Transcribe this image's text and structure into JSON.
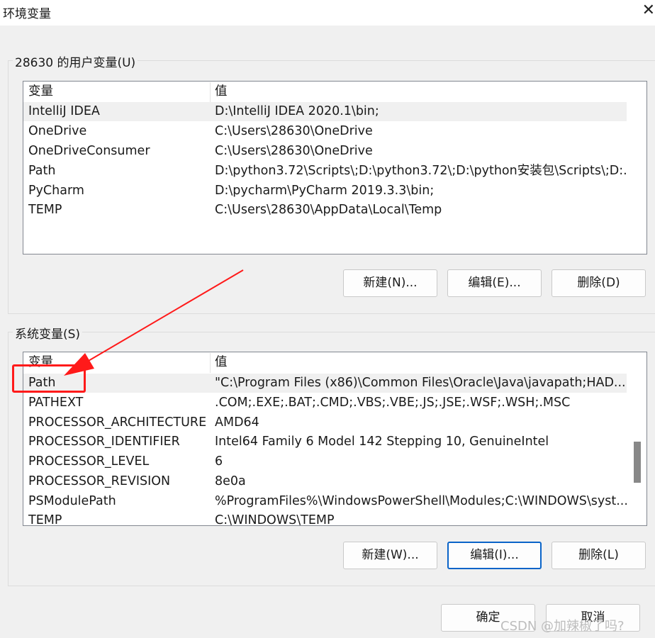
{
  "window": {
    "title": "环境变量",
    "close_glyph": "✕"
  },
  "user_vars": {
    "label": "28630 的用户变量(U)",
    "headers": {
      "var": "变量",
      "val": "值"
    },
    "rows": [
      {
        "var": "IntelliJ IDEA",
        "val": "D:\\IntelliJ IDEA 2020.1\\bin;"
      },
      {
        "var": "OneDrive",
        "val": "C:\\Users\\28630\\OneDrive"
      },
      {
        "var": "OneDriveConsumer",
        "val": "C:\\Users\\28630\\OneDrive"
      },
      {
        "var": "Path",
        "val": "D:\\python3.72\\Scripts\\;D:\\python3.72\\;D:\\python安装包\\Scripts\\;D:..."
      },
      {
        "var": "PyCharm",
        "val": "D:\\pycharm\\PyCharm 2019.3.3\\bin;"
      },
      {
        "var": "TEMP",
        "val": "C:\\Users\\28630\\AppData\\Local\\Temp"
      }
    ],
    "selected_index": 0,
    "buttons": {
      "new": "新建(N)...",
      "edit": "编辑(E)...",
      "delete": "删除(D)"
    }
  },
  "system_vars": {
    "label": "系统变量(S)",
    "headers": {
      "var": "变量",
      "val": "值"
    },
    "rows": [
      {
        "var": "Path",
        "val": "\"C:\\Program Files (x86)\\Common Files\\Oracle\\Java\\javapath;HAD..."
      },
      {
        "var": "PATHEXT",
        "val": ".COM;.EXE;.BAT;.CMD;.VBS;.VBE;.JS;.JSE;.WSF;.WSH;.MSC"
      },
      {
        "var": "PROCESSOR_ARCHITECTURE",
        "val": "AMD64"
      },
      {
        "var": "PROCESSOR_IDENTIFIER",
        "val": "Intel64 Family 6 Model 142 Stepping 10, GenuineIntel"
      },
      {
        "var": "PROCESSOR_LEVEL",
        "val": "6"
      },
      {
        "var": "PROCESSOR_REVISION",
        "val": "8e0a"
      },
      {
        "var": "PSModulePath",
        "val": "%ProgramFiles%\\WindowsPowerShell\\Modules;C:\\WINDOWS\\syst..."
      },
      {
        "var": "TEMP",
        "val": "C:\\WINDOWS\\TEMP"
      }
    ],
    "selected_index": 0,
    "buttons": {
      "new": "新建(W)...",
      "edit": "编辑(I)...",
      "delete": "删除(L)"
    }
  },
  "footer": {
    "ok": "确定",
    "cancel": "取消"
  },
  "watermark": "CSDN @加辣椒了吗?",
  "colors": {
    "annotation": "#ff1a1a",
    "focus_border": "#0a64c8",
    "selection": "#f0f0f0"
  }
}
